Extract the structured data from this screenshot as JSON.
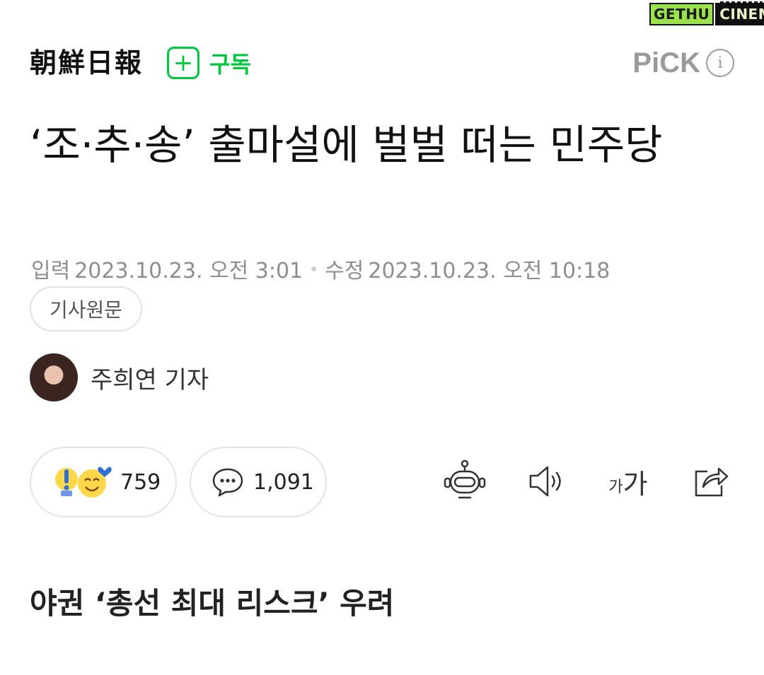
{
  "watermark": {
    "part1": "GETHU",
    "part2": "CINEMA"
  },
  "header": {
    "press_name": "朝鮮日報",
    "subscribe_label": "구독",
    "pick_label": "PiCK",
    "pick_info_icon": "i"
  },
  "article": {
    "title": "‘조·추·송’ 출마설에 벌벌 떠는 민주당",
    "input_label": "입력",
    "input_time": "2023.10.23. 오전 3:01",
    "edit_label": "수정",
    "edit_time": "2023.10.23. 오전 10:18",
    "original_button": "기사원문",
    "reporter": "주희연 기자",
    "subheading": "야권 ‘총선 최대 리스크’ 우려"
  },
  "actions": {
    "reaction_count": "759",
    "comment_count": "1,091",
    "font_small": "가",
    "font_large": "가"
  },
  "colors": {
    "accent_green": "#00c73c",
    "muted_gray": "#9a9a9a"
  }
}
